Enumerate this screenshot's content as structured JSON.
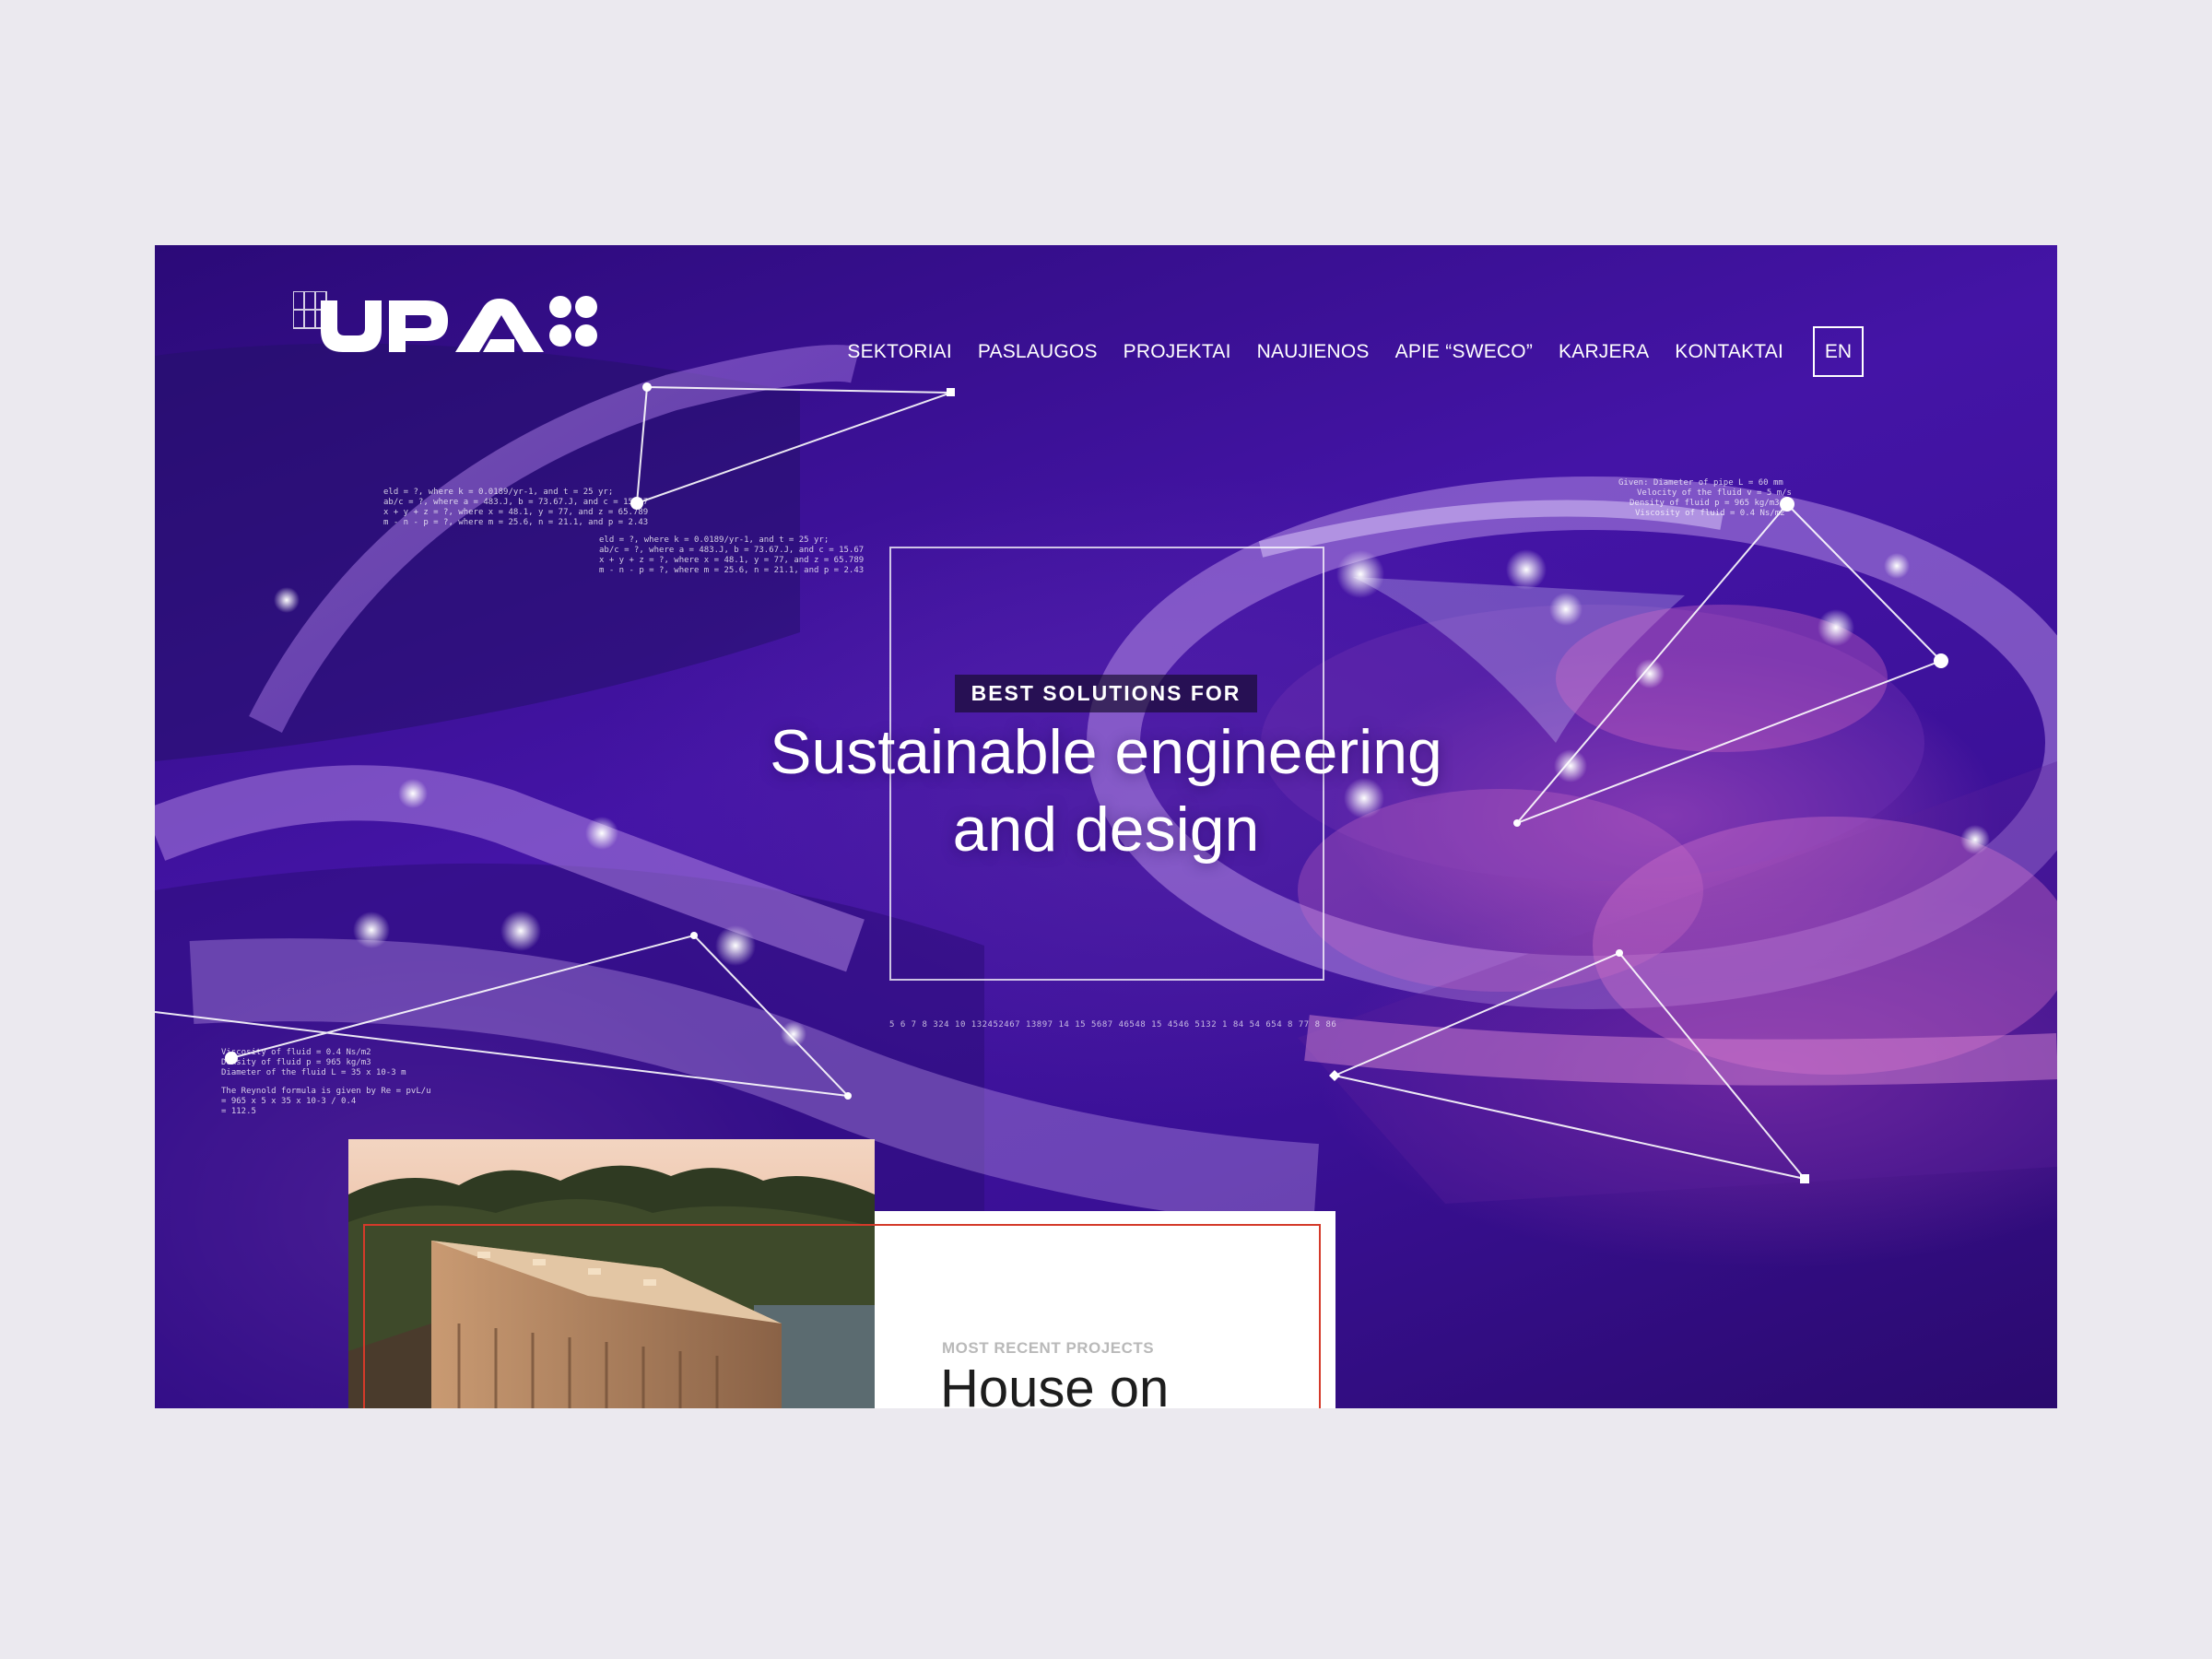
{
  "brand": {
    "name": "UPA"
  },
  "nav": {
    "items": [
      "SEKTORIAI",
      "PASLAUGOS",
      "PROJEKTAI",
      "NAUJIENOS",
      "APIE “SWECO”",
      "KARJERA",
      "KONTAKTAI"
    ],
    "language": "EN"
  },
  "hero": {
    "eyebrow": "BEST SOLUTIONS FOR",
    "title_line1": "Sustainable engineering",
    "title_line2": "and design",
    "number_strip": "5 6 7 8 324 10 132452467 13897 14 15 5687 46548 15 4546 5132 1 84 54 654 8 77 8 86",
    "formula_block_1": "eld = ?, where k = 0.0189/yr-1, and t = 25 yr; ab/c = ?, where a = 483.J, b = 73.67.J, and c = 15.67 x + y + z = ?, where x = 48.1, y = 77, and z = 65.789 m - n - p = ?, where m = 25.6, n = 21.1, and p = 2.43",
    "formula_block_2": "eld = ?, where k = 0.0189/yr-1, and t = 25 yr; ab/c = ?, where a = 483.J, b = 73.67.J, and c = 15.67 x + y + z = ?, where x = 48.1, y = 77, and z = 65.789 m - n - p = ?, where m = 25.6, n = 21.1, and p = 2.43",
    "formula_block_3": "Given: Diameter of pipe L = 60 mm Velocity of the fluid v = 5 m/s Density of fluid p = 965 kg/m3 Viscosity of fluid = 0.4 Ns/m2",
    "formula_block_4": "Viscosity of fluid = 0.4 Ns/m2 Density of fluid p = 965 kg/m3 Diameter of the fluid L = 35 x 10-3 m The Reynold formula is given by Re = pvL/u = 965 x 5 x 35 x 10-3 / 0.4 = 112.5"
  },
  "recent": {
    "eyebrow": "MOST RECENT PROJECTS",
    "title": "House on"
  },
  "colors": {
    "page_bg": "#ebe9ef",
    "hero_purple": "#3a0f8f",
    "accent_red": "#d43a2a",
    "white": "#ffffff"
  }
}
